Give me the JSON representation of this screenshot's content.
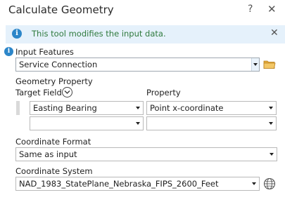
{
  "dialog": {
    "title": "Calculate Geometry",
    "help_label": "?",
    "close_label": "✕"
  },
  "info_bar": {
    "icon_glyph": "i",
    "text": "This tool modifies the input data.",
    "close_label": "✕"
  },
  "input_features": {
    "required_icon_glyph": "i",
    "label": "Input Features",
    "value": "Service Connection"
  },
  "geometry_property": {
    "section_label": "Geometry Property",
    "target_field_header": "Target Field",
    "property_header": "Property",
    "rows": [
      {
        "target_field": "Easting Bearing",
        "property": "Point x-coordinate"
      },
      {
        "target_field": "",
        "property": ""
      }
    ]
  },
  "coordinate_format": {
    "label": "Coordinate Format",
    "value": "Same as input"
  },
  "coordinate_system": {
    "label": "Coordinate System",
    "value": "NAD_1983_StatePlane_Nebraska_FIPS_2600_Feet"
  },
  "icons": {
    "info": "info-icon",
    "folder": "folder-icon",
    "expand": "chevron-down-icon",
    "globe": "globe-icon"
  },
  "colors": {
    "info_bar_bg": "#e5f1fb",
    "info_text": "#2f7a3d",
    "info_icon": "#2c86c9",
    "folder": "#e2a93a"
  }
}
